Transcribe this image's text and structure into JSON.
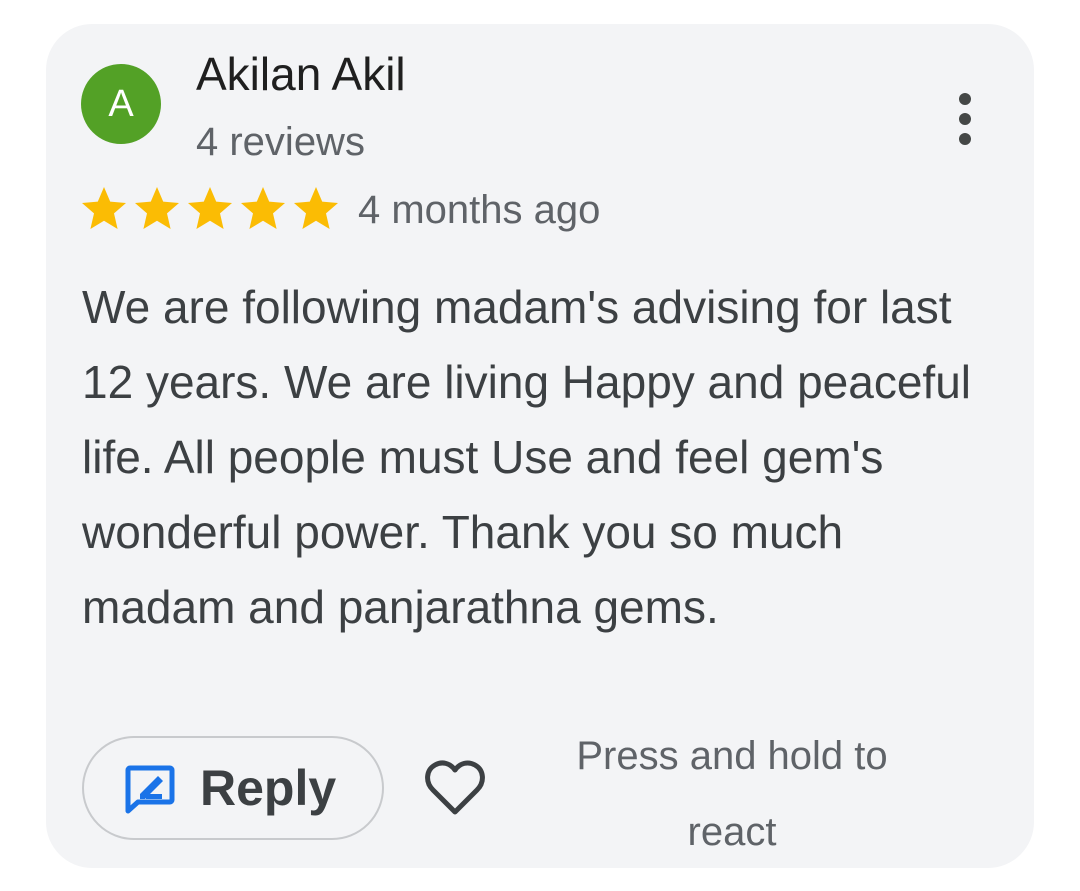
{
  "reviewer": {
    "avatar_letter": "A",
    "avatar_color": "#53a126",
    "name": "Akilan Akil",
    "review_count": "4 reviews"
  },
  "rating": {
    "stars": 5,
    "max_stars": 5,
    "star_color": "#fbbc04"
  },
  "timestamp": "4 months ago",
  "review_text": "We are following madam's advising for last 12 years. We are living Happy and peaceful life. All people must Use and feel gem's wonderful power. Thank you so much madam and panjarathna gems.",
  "actions": {
    "reply_label": "Reply",
    "reply_icon": "reply-edit-icon",
    "reply_icon_color": "#1a73e8",
    "react_icon": "heart-outline-icon",
    "press_hint": "Press and hold to react"
  },
  "menu_icon": "more-vert-icon"
}
